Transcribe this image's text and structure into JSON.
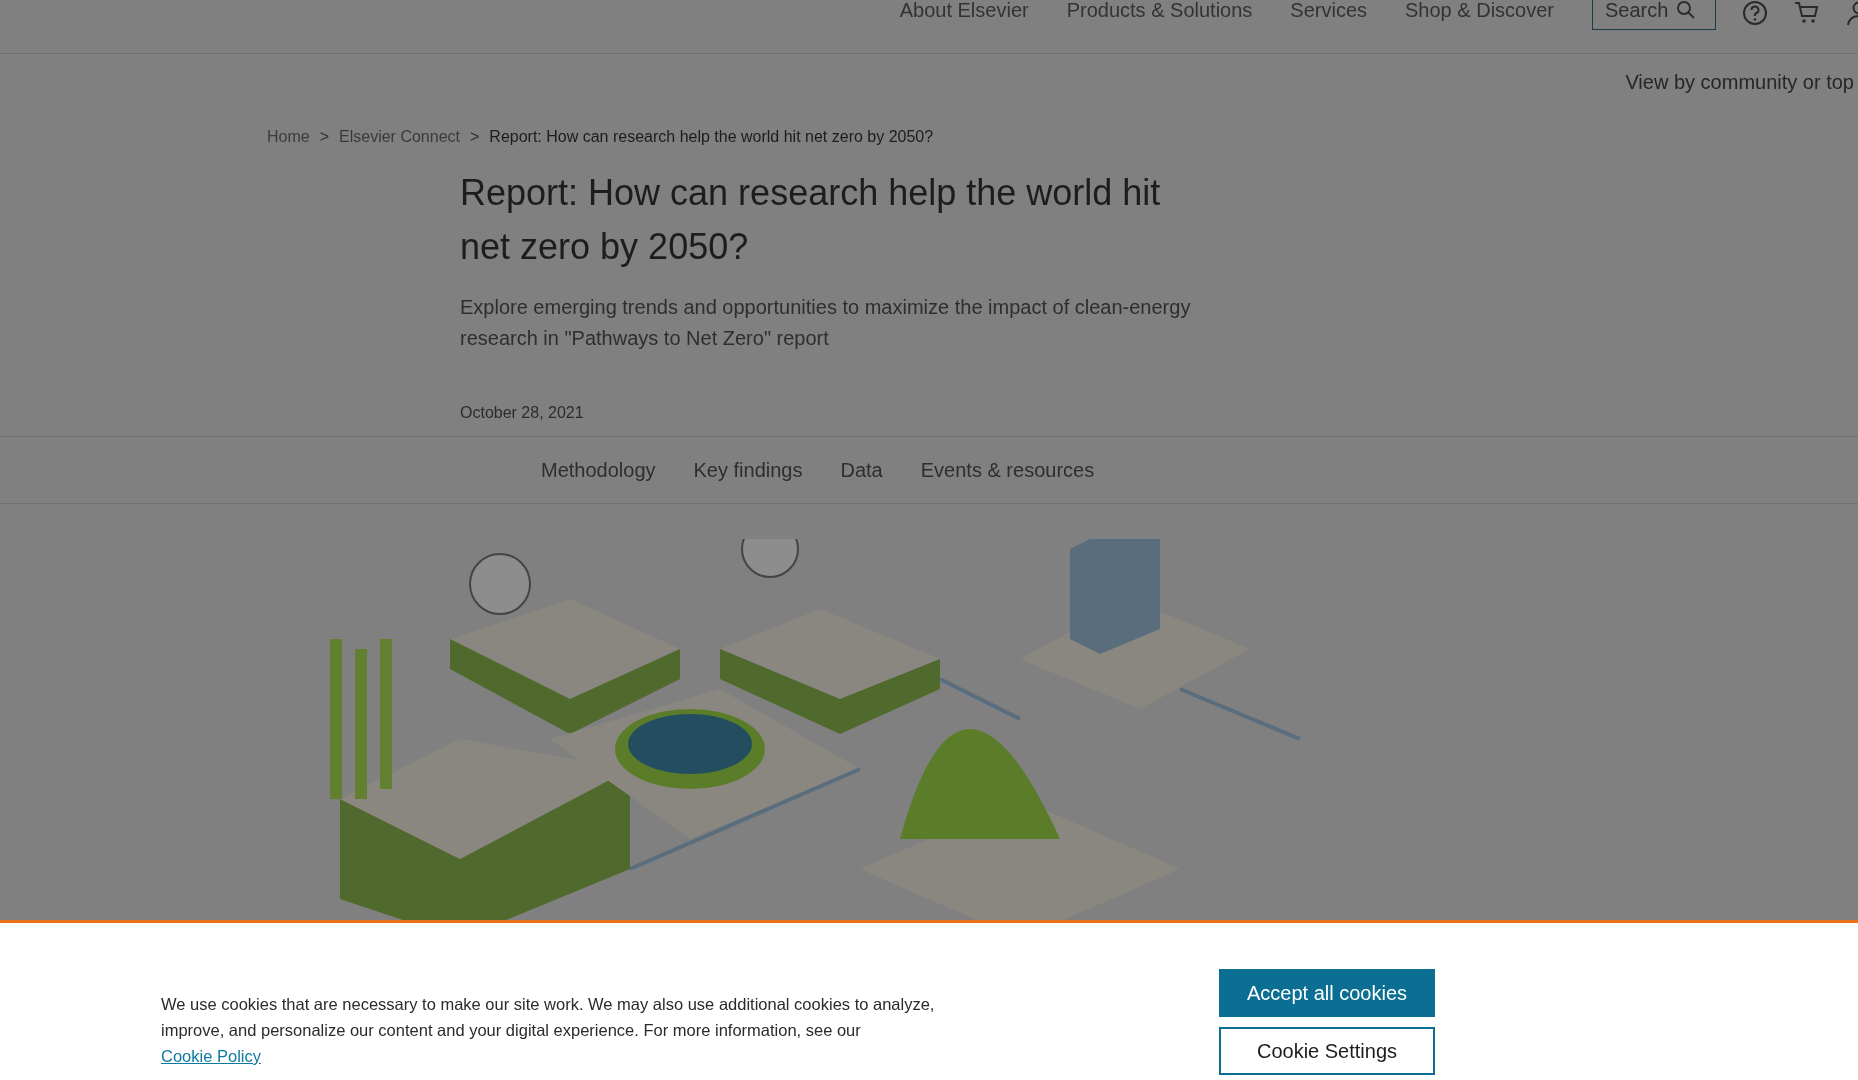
{
  "header": {
    "nav": [
      "About Elsevier",
      "Products & Solutions",
      "Services",
      "Shop & Discover"
    ],
    "search": {
      "label": "Search"
    }
  },
  "subnav": {
    "link": "View by community or top"
  },
  "breadcrumb": {
    "separator": ">",
    "items": [
      "Home",
      "Elsevier Connect",
      "Report: How can research help the world hit net zero by 2050?"
    ]
  },
  "article": {
    "title": "Report: How can research help the world hit net zero by 2050?",
    "subtitle": "Explore emerging trends and opportunities to maximize the impact of clean-energy research in \"Pathways to Net Zero\" report",
    "date": "October 28, 2021"
  },
  "tabs": [
    "Methodology",
    "Key findings",
    "Data",
    "Events & resources"
  ],
  "cookie_banner": {
    "text": "We use cookies that are necessary to make our site work. We may also use additional cookies to analyze, improve, and personalize our content and your digital experience. For more information, see our",
    "link": "Cookie Policy",
    "buttons": [
      {
        "label": "Accept all cookies",
        "kind": "primary"
      },
      {
        "label": "Cookie Settings",
        "kind": "secondary"
      }
    ]
  }
}
